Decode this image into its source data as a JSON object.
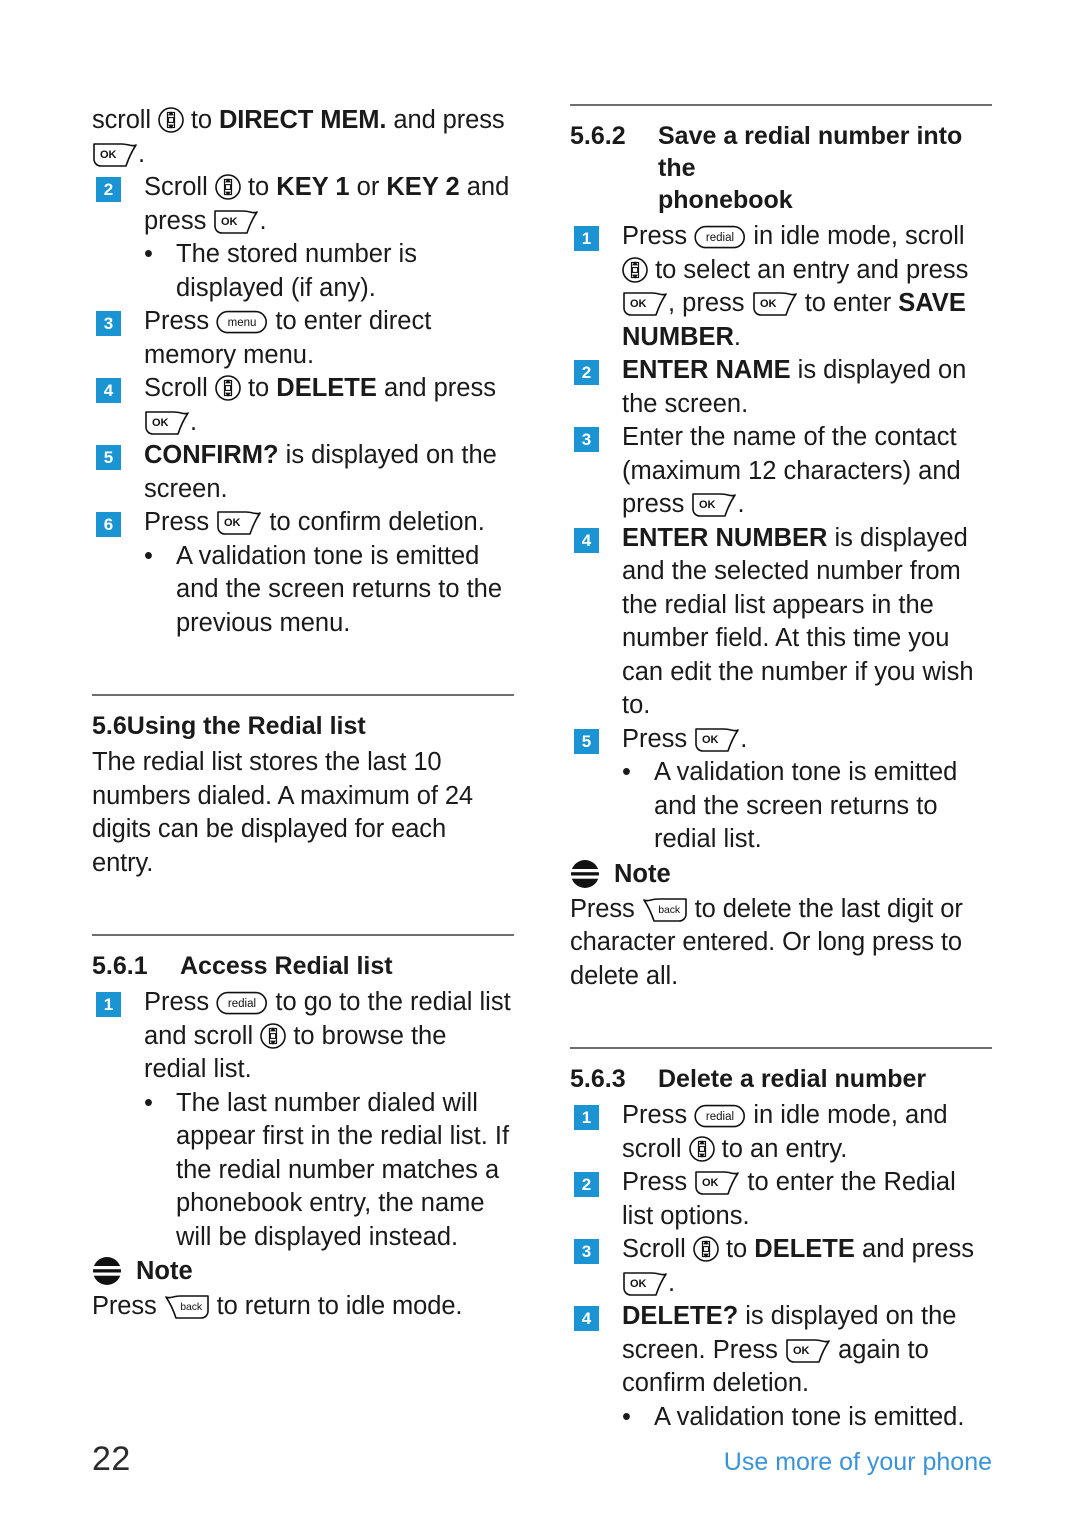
{
  "document": {
    "page_number": "22",
    "footer_note": "Use more of your phone",
    "accent_color": "#1b94d3",
    "footer_link_color": "#3b93d9"
  },
  "icons": {
    "scroll": "scroll-updown-key-icon",
    "ok": "ok-softkey-icon",
    "back": "back-softkey-icon",
    "menu": "menu-key-icon",
    "redial": "redial-key-icon",
    "note": "note-icon",
    "ok_label": "OK",
    "back_label": "back",
    "menu_label": "menu",
    "redial_label": "redial"
  },
  "left_column": {
    "direct_mem": {
      "step1_tail_a": "scroll ",
      "step1_tail_b": " to ",
      "step1_tail_bold": "DIRECT MEM.",
      "step1_tail_c": " and press ",
      "step1_tail_d": ".",
      "steps": [
        {
          "num": "2",
          "a": "Scroll ",
          "b": " to ",
          "bold1": "KEY 1",
          "c": " or ",
          "bold2": "KEY 2",
          "d": " and press ",
          "e": "."
        },
        {
          "num": "3",
          "a": "Press ",
          "b": " to enter direct memory menu."
        },
        {
          "num": "4",
          "a": "Scroll ",
          "b": " to ",
          "bold1": "DELETE",
          "c": " and press ",
          "d": "."
        },
        {
          "num": "5",
          "bold1": "CONFIRM?",
          "a": " is displayed on the screen."
        },
        {
          "num": "6",
          "a": "Press ",
          "b": " to confirm deletion."
        }
      ],
      "bullet_after_step2": "The stored number is displayed (if any).",
      "bullet_after_step6": "A validation tone is emitted and the screen returns to the previous menu."
    },
    "section_5_6": {
      "number": "5.6",
      "title": "Using the Redial list",
      "body": "The redial list stores the last 10 numbers dialed. A maximum of 24 digits can be displayed for each entry."
    },
    "section_5_6_1": {
      "number": "5.6.1",
      "title": "Access Redial list",
      "step1": {
        "num": "1",
        "a": "Press ",
        "b": " to go to the redial list and scroll ",
        "c": " to browse the redial list."
      },
      "bullet": "The last number dialed will appear first in the redial list. If the redial number matches a phonebook entry, the name will be displayed instead.",
      "note": {
        "title": "Note",
        "a": "Press ",
        "b": " to return to idle mode."
      }
    }
  },
  "right_column": {
    "section_5_6_2": {
      "number": "5.6.2",
      "title_line1": "Save a redial number into the",
      "title_line2": "phonebook",
      "steps": [
        {
          "num": "1",
          "a": "Press ",
          "b": " in idle mode, scroll ",
          "c": " to select an entry and press ",
          "d": ", press ",
          "e": " to enter ",
          "bold1": "SAVE NUMBER",
          "f": "."
        },
        {
          "num": "2",
          "bold1": "ENTER NAME",
          "a": " is displayed on the screen."
        },
        {
          "num": "3",
          "a": "Enter the name of the contact (maximum 12 characters) and press ",
          "b": "."
        },
        {
          "num": "4",
          "bold1": "ENTER NUMBER",
          "a": " is displayed and the selected number from the redial list appears in the number field. At this time you can edit the number if you wish to."
        },
        {
          "num": "5",
          "a": "Press ",
          "b": "."
        }
      ],
      "bullet_after_step5": "A validation tone is emitted and the screen returns to redial list.",
      "note": {
        "title": "Note",
        "a": "Press ",
        "b": " to delete the last digit or character entered. Or long press to delete all."
      }
    },
    "section_5_6_3": {
      "number": "5.6.3",
      "title": "Delete a redial number",
      "steps": [
        {
          "num": "1",
          "a": "Press ",
          "b": " in idle mode, and scroll ",
          "c": " to an entry."
        },
        {
          "num": "2",
          "a": "Press ",
          "b": " to enter the Redial list options."
        },
        {
          "num": "3",
          "a": "Scroll ",
          "b": " to ",
          "bold1": "DELETE",
          "c": " and press ",
          "d": "."
        },
        {
          "num": "4",
          "bold1": "DELETE?",
          "a": " is displayed on the screen. Press ",
          "b": " again to confirm deletion."
        }
      ],
      "bullet_after_step4": "A validation tone is emitted."
    }
  }
}
